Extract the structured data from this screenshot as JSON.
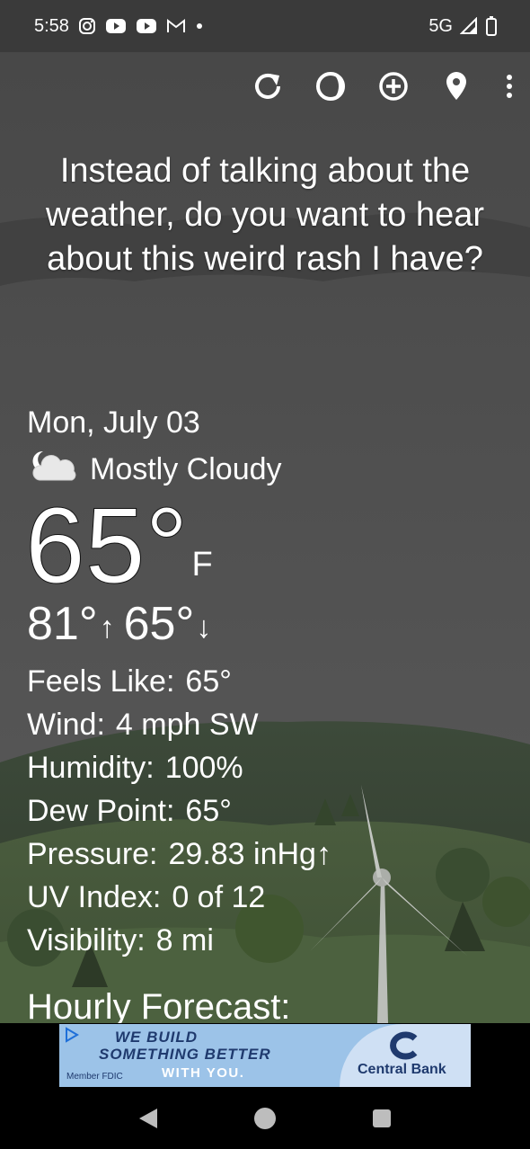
{
  "status_bar": {
    "time": "5:58",
    "network": "5G",
    "notification_icons": [
      "instagram-icon",
      "youtube-icon",
      "youtube-icon",
      "gmail-icon",
      "dot-icon"
    ]
  },
  "toolbar": {
    "icons": [
      "refresh-icon",
      "theme-icon",
      "add-location-icon",
      "location-pin-icon",
      "more-vert-icon"
    ]
  },
  "headline": "Instead of talking about the weather, do you want to hear about this weird rash I have?",
  "current": {
    "date": "Mon, July 03",
    "condition": "Mostly Cloudy",
    "condition_icon": "partly-cloudy-night-icon",
    "temperature": "65°",
    "unit": "F",
    "high": "81°",
    "low": "65°"
  },
  "details": [
    {
      "label": "Feels Like:",
      "value": "65°"
    },
    {
      "label": "Wind:",
      "value": "4 mph SW"
    },
    {
      "label": "Humidity:",
      "value": "100%"
    },
    {
      "label": "Dew Point:",
      "value": "65°"
    },
    {
      "label": "Pressure:",
      "value": "29.83 inHg↑"
    },
    {
      "label": "UV Index:",
      "value": "0 of 12"
    },
    {
      "label": "Visibility:",
      "value": "8 mi"
    }
  ],
  "hourly_heading": "Hourly Forecast:",
  "ad": {
    "line1": "WE BUILD",
    "line2": "SOMETHING BETTER",
    "line3": "WITH YOU.",
    "fdic": "Member FDIC",
    "brand": "Central Bank"
  },
  "nav": {
    "icons": [
      "back-icon",
      "home-icon",
      "recents-icon"
    ]
  },
  "colors": {
    "background": "#4f4f4f",
    "status_bar": "#3a3a3a",
    "ad_blue": "#9cc3e8",
    "ad_navy": "#1f3a6e"
  }
}
